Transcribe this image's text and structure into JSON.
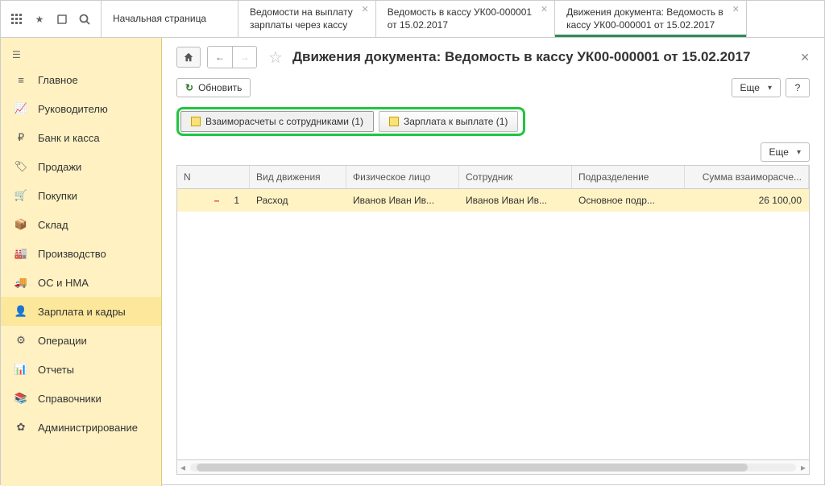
{
  "topTabs": [
    {
      "line1": "Начальная страница",
      "line2": "",
      "closable": false
    },
    {
      "line1": "Ведомости на выплату",
      "line2": "зарплаты через кассу",
      "closable": true
    },
    {
      "line1": "Ведомость в кассу УК00-000001",
      "line2": "от 15.02.2017",
      "closable": true
    },
    {
      "line1": "Движения документа: Ведомость в",
      "line2": "кассу УК00-000001 от 15.02.2017",
      "closable": true,
      "active": true
    }
  ],
  "sidebar": {
    "items": [
      {
        "label": "Главное"
      },
      {
        "label": "Руководителю"
      },
      {
        "label": "Банк и касса"
      },
      {
        "label": "Продажи"
      },
      {
        "label": "Покупки"
      },
      {
        "label": "Склад"
      },
      {
        "label": "Производство"
      },
      {
        "label": "ОС и НМА"
      },
      {
        "label": "Зарплата и кадры",
        "selected": true
      },
      {
        "label": "Операции"
      },
      {
        "label": "Отчеты"
      },
      {
        "label": "Справочники"
      },
      {
        "label": "Администрирование"
      }
    ]
  },
  "title": "Движения документа: Ведомость в кассу УК00-000001 от 15.02.2017",
  "buttons": {
    "refresh": "Обновить",
    "more": "Еще",
    "help": "?"
  },
  "registerTabs": [
    {
      "label": "Взаиморасчеты с сотрудниками (1)",
      "active": true
    },
    {
      "label": "Зарплата к выплате (1)"
    }
  ],
  "table": {
    "columns": [
      "N",
      "Вид движения",
      "Физическое лицо",
      "Сотрудник",
      "Подразделение",
      "Сумма взаиморасче..."
    ],
    "rows": [
      {
        "n": "1",
        "type": "Расход",
        "person": "Иванов Иван Ив...",
        "emp": "Иванов Иван Ив...",
        "dept": "Основное подр...",
        "sum": "26 100,00"
      }
    ]
  }
}
